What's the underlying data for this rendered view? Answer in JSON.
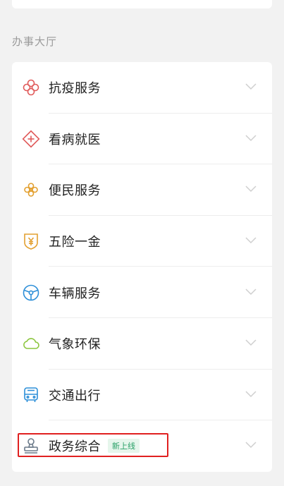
{
  "section": {
    "title": "办事大厅"
  },
  "items": [
    {
      "label": "抗疫服务",
      "icon": "flower-icon",
      "color": "#e05a5a"
    },
    {
      "label": "看病就医",
      "icon": "medical-cross-icon",
      "color": "#e05a5a"
    },
    {
      "label": "便民服务",
      "icon": "clover-icon",
      "color": "#e3a030"
    },
    {
      "label": "五险一金",
      "icon": "yuan-shield-icon",
      "color": "#e3a030"
    },
    {
      "label": "车辆服务",
      "icon": "steering-wheel-icon",
      "color": "#2d8fd8"
    },
    {
      "label": "气象环保",
      "icon": "cloud-icon",
      "color": "#8cc63f"
    },
    {
      "label": "交通出行",
      "icon": "bus-icon",
      "color": "#2d8fd8"
    },
    {
      "label": "政务综合",
      "icon": "stamp-icon",
      "color": "#6b7a8a",
      "badge": "新上线"
    }
  ]
}
